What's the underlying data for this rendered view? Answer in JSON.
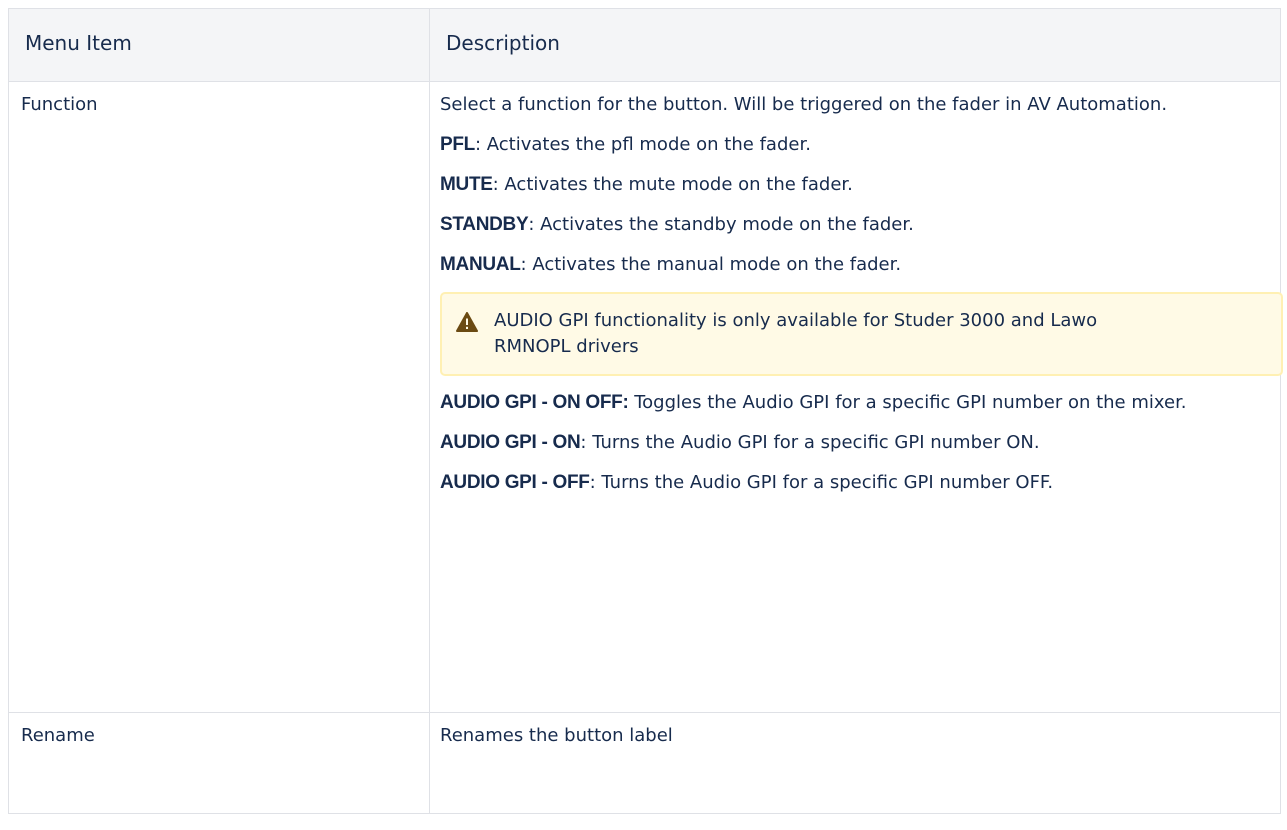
{
  "table": {
    "headers": {
      "menu_item": "Menu Item",
      "description": "Description"
    },
    "rows": [
      {
        "item": "Function",
        "intro": "Select a function for the button. Will be triggered on the fader in AV Automation.",
        "options": [
          {
            "term": "PFL",
            "text": ": Activates the pfl mode on the fader."
          },
          {
            "term": "MUTE",
            "text": ": Activates the mute mode on the fader."
          },
          {
            "term": "STANDBY",
            "text": ": Activates the standby mode on the fader."
          },
          {
            "term": "MANUAL",
            "text": ": Activates the manual mode on the fader."
          }
        ],
        "warning": {
          "icon": "warning-icon",
          "text": "AUDIO GPI functionality is only available for Studer 3000 and Lawo RMNOPL drivers",
          "color": "#fffae6",
          "border_color": "#fff0b3",
          "icon_color": "#6b4a12"
        },
        "gpi_options": [
          {
            "term": "AUDIO GPI - ON OFF:",
            "text": " Toggles the Audio GPI for a specific GPI number on the mixer."
          },
          {
            "term": "AUDIO GPI - ON",
            "text": ": Turns the Audio GPI for a specific GPI number ON."
          },
          {
            "term": "AUDIO GPI - OFF",
            "text": ": Turns the Audio GPI for a specific GPI number OFF."
          }
        ]
      },
      {
        "item": "Rename",
        "description": "Renames the button label"
      }
    ]
  }
}
